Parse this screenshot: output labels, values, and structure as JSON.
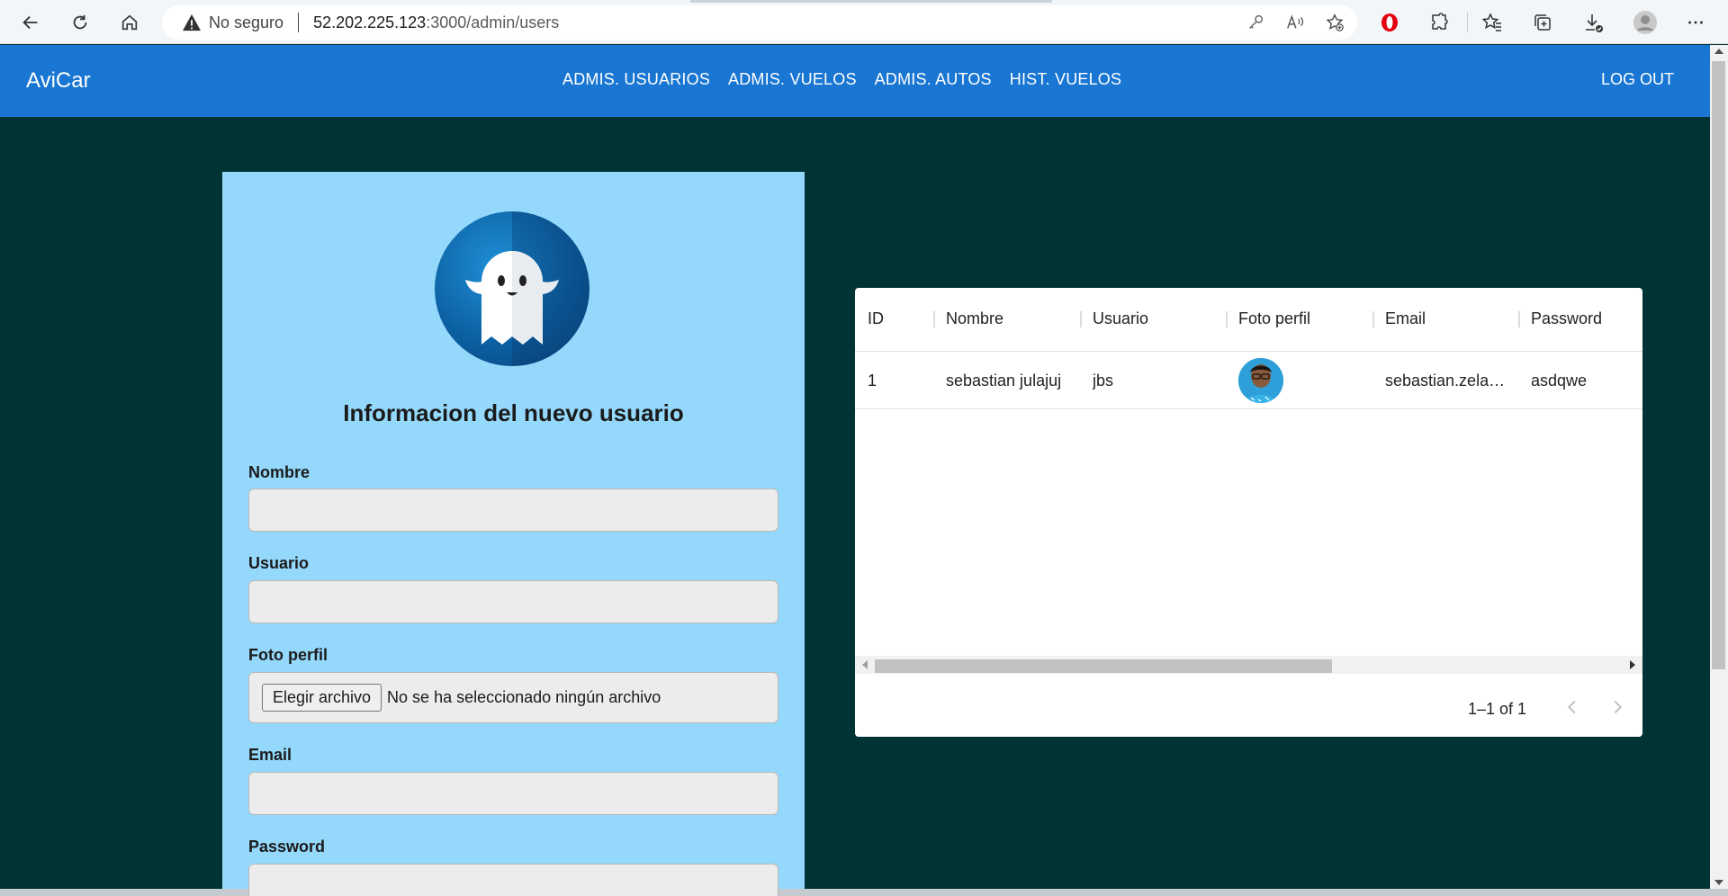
{
  "browser": {
    "security_label": "No seguro",
    "url_host": "52.202.225.123",
    "url_path": ":3000/admin/users"
  },
  "app": {
    "brand": "AviCar",
    "nav": [
      {
        "label": "ADMIS. USUARIOS"
      },
      {
        "label": "ADMIS. VUELOS"
      },
      {
        "label": "ADMIS. AUTOS"
      },
      {
        "label": "HIST. VUELOS"
      }
    ],
    "logout": "LOG OUT"
  },
  "form": {
    "title": "Informacion del nuevo usuario",
    "fields": {
      "nombre": {
        "label": "Nombre",
        "value": ""
      },
      "usuario": {
        "label": "Usuario",
        "value": ""
      },
      "foto": {
        "label": "Foto perfil",
        "button": "Elegir archivo",
        "status": "No se ha seleccionado ningún archivo"
      },
      "email": {
        "label": "Email",
        "value": ""
      },
      "password": {
        "label": "Password",
        "value": ""
      }
    }
  },
  "grid": {
    "columns": [
      "ID",
      "Nombre",
      "Usuario",
      "Foto perfil",
      "Email",
      "Password"
    ],
    "rows": [
      {
        "id": "1",
        "nombre": "sebastian julajuj",
        "usuario": "jbs",
        "email": "sebastian.zela…",
        "password": "asdqwe"
      }
    ],
    "pagination": "1–1 of 1"
  },
  "colors": {
    "page_bg": "#003333",
    "header_bg": "#1976d2",
    "form_bg": "#94d9fc"
  }
}
